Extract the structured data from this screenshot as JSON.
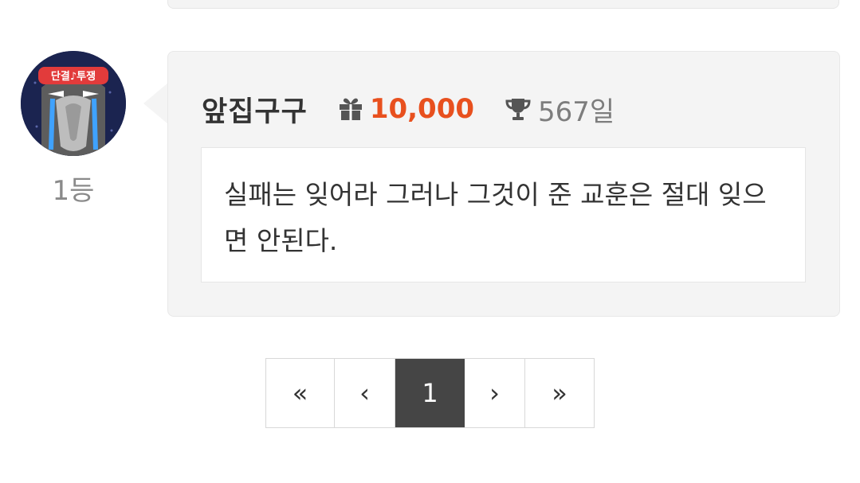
{
  "comment": {
    "rank": "1등",
    "nickname": "앞집구구",
    "points": "10,000",
    "days": "567일",
    "text": "실패는 잊어라 그러나 그것이 준 교훈은 절대 잊으면 안된다.",
    "avatar_caption": "단결♪투쟁"
  },
  "icons": {
    "points": "gift-icon",
    "days": "trophy-icon"
  },
  "colors": {
    "points": "#e8501e",
    "active_page": "#454545",
    "card_bg": "#f4f4f4"
  },
  "pagination": {
    "first": "«",
    "prev": "‹",
    "current": "1",
    "next": "›",
    "last": "»"
  }
}
